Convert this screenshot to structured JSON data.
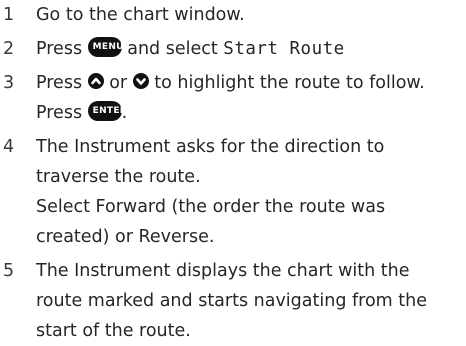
{
  "steps": [
    {
      "number": "1",
      "text": "Go to the chart window."
    },
    {
      "number": "2",
      "before": "Press",
      "button": "MENU",
      "middle": "and select",
      "code": "Start Route"
    },
    {
      "number": "3",
      "before": "Press",
      "up_icon": "up-arrow-button-icon",
      "or": "or",
      "down_icon": "down-arrow-button-icon",
      "after": "to highlight the route to follow.",
      "line2_before": "Press",
      "button": "ENTER",
      "line2_after": "."
    },
    {
      "number": "4",
      "lines": [
        "The Instrument asks for the direction to",
        "traverse the route.",
        "Select Forward (the order the route was",
        "created) or Reverse."
      ]
    },
    {
      "number": "5",
      "lines": [
        "The Instrument displays the chart with the",
        "route marked and starts navigating from the",
        "start of the route."
      ]
    }
  ]
}
